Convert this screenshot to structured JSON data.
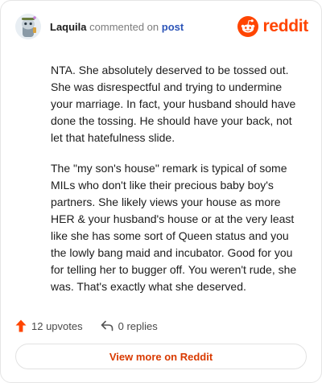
{
  "header": {
    "username": "Laquila",
    "verb": "commented on",
    "post_link": "post",
    "brand_word": "reddit"
  },
  "comment": {
    "paragraphs": [
      "NTA. She absolutely deserved to be tossed out. She was disrespectful and trying to undermine your marriage. In fact, your husband should have done the tossing. He should have your back, not let that hatefulness slide.",
      "The \"my son's house\" remark is typical of some MILs who don't like their precious baby boy's partners. She likely views your house as more HER & your husband's house or at the very least like she has some sort of Queen status and you the lowly bang maid and incubator. Good for you for telling her to bugger off. You weren't rude, she was. That's exactly what she deserved."
    ]
  },
  "actions": {
    "upvotes": "12 upvotes",
    "replies": "0 replies"
  },
  "footer": {
    "view_more": "View more on Reddit"
  },
  "colors": {
    "brand": "#ff4500",
    "link": "#2d55b8",
    "view_more": "#d93a00"
  },
  "icons": {
    "avatar": "snoo-avatar",
    "brand": "reddit-snoo-logo",
    "upvote": "upvote-arrow-icon",
    "reply": "reply-arrow-icon"
  }
}
